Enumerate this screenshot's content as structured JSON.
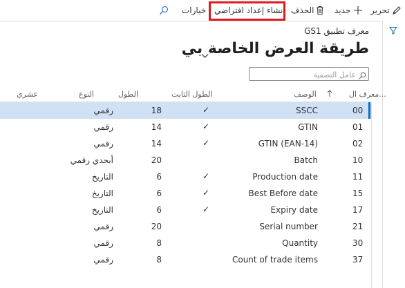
{
  "toolbar": {
    "edit_label": "تحرير",
    "new_label": "جديد",
    "delete_label": "الحذف",
    "create_default_label": "إنشاء إعداد افتراضي",
    "options_label": "خيارات"
  },
  "header": {
    "breadcrumb": "معرف تطبيق GS1",
    "title": "طريقة العرض الخاصة بي"
  },
  "filter": {
    "placeholder": "عامل التصفية"
  },
  "table": {
    "columns": {
      "id": "معرف ال...",
      "description": "الوصف",
      "fixed_length": "الطول الثابت",
      "length": "الطول",
      "type": "النوع",
      "decimal": "عشري"
    },
    "rows": [
      {
        "id": "00",
        "description": "SSCC",
        "fixed": "✓",
        "length": "18",
        "type": "رقمي"
      },
      {
        "id": "01",
        "description": "GTIN",
        "fixed": "✓",
        "length": "14",
        "type": "رقمي"
      },
      {
        "id": "02",
        "description": "GTIN (EAN-14)",
        "fixed": "✓",
        "length": "14",
        "type": "رقمي"
      },
      {
        "id": "10",
        "description": "Batch",
        "fixed": "",
        "length": "20",
        "type": "أبجدي رقمي"
      },
      {
        "id": "11",
        "description": "Production date",
        "fixed": "✓",
        "length": "6",
        "type": "التاريخ"
      },
      {
        "id": "15",
        "description": "Best Before date",
        "fixed": "✓",
        "length": "6",
        "type": "التاريخ"
      },
      {
        "id": "17",
        "description": "Expiry date",
        "fixed": "✓",
        "length": "6",
        "type": "التاريخ"
      },
      {
        "id": "21",
        "description": "Serial number",
        "fixed": "",
        "length": "20",
        "type": "رقمي"
      },
      {
        "id": "30",
        "description": "Quantity",
        "fixed": "",
        "length": "8",
        "type": "رقمي"
      },
      {
        "id": "37",
        "description": "Count of trade items",
        "fixed": "",
        "length": "8",
        "type": "رقمي"
      }
    ]
  },
  "colors": {
    "accent": "#0f6cbd",
    "selected_row": "#d0e0f5",
    "highlight": "#e0191e"
  }
}
